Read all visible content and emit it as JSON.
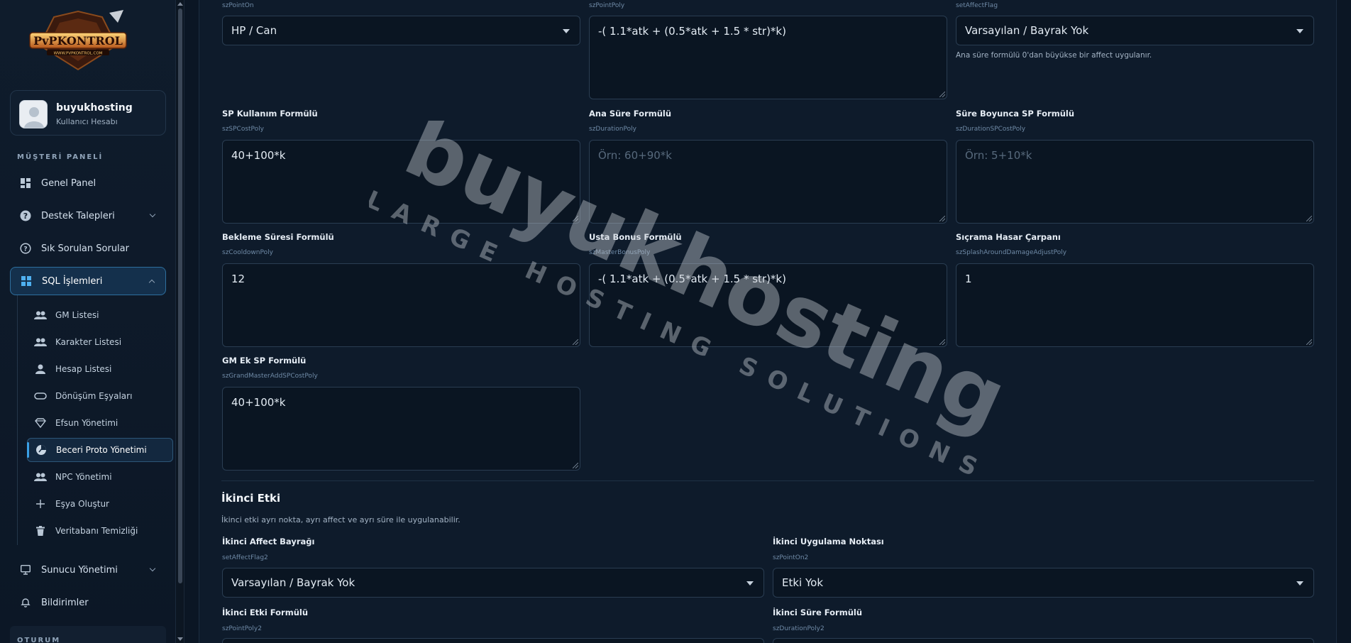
{
  "brand": {
    "logo_text": "PvPKONTROL",
    "logo_sub": "WWW.PVPKONTROL.COM"
  },
  "user": {
    "name": "buyukhosting",
    "role": "Kullanıcı Hesabı"
  },
  "sidebar": {
    "section_label": "MÜŞTERİ PANELİ",
    "items": [
      {
        "label": "Genel Panel",
        "icon": "dashboard-icon"
      },
      {
        "label": "Destek Talepleri",
        "icon": "question-icon"
      },
      {
        "label": "Sık Sorulan Sorular",
        "icon": "help-circle-icon"
      },
      {
        "label": "SQL İşlemleri",
        "icon": "grid-icon"
      }
    ],
    "subitems": [
      {
        "label": "GM Listesi",
        "icon": "users-icon"
      },
      {
        "label": "Karakter Listesi",
        "icon": "users-icon"
      },
      {
        "label": "Hesap Listesi",
        "icon": "user-icon"
      },
      {
        "label": "Dönüşüm Eşyaları",
        "icon": "ring-icon"
      },
      {
        "label": "Efsun Yönetimi",
        "icon": "diamond-icon"
      },
      {
        "label": "Beceri Proto Yönetimi",
        "icon": "pie-icon"
      },
      {
        "label": "NPC Yönetimi",
        "icon": "users-icon"
      },
      {
        "label": "Eşya Oluştur",
        "icon": "plus-icon"
      },
      {
        "label": "Veritabanı Temizliği",
        "icon": "trash-icon"
      }
    ],
    "bottom_items": [
      {
        "label": "Sunucu Yönetimi",
        "icon": "monitor-icon"
      },
      {
        "label": "Bildirimler",
        "icon": "bell-icon"
      }
    ],
    "session_label": "OTURUM"
  },
  "form": {
    "top": {
      "point_on": {
        "key": "szPointOn",
        "value": "HP / Can"
      },
      "point_poly": {
        "key": "szPointPoly",
        "value": "-( 1.1*atk + (0.5*atk +  1.5 * str)*k)"
      },
      "affect_flag": {
        "key": "setAffectFlag",
        "value": "Varsayılan / Bayrak Yok",
        "hint": "Ana süre formülü 0'dan büyükse bir affect uygulanır."
      }
    },
    "sp_cost": {
      "label": "SP Kullanım Formülü",
      "key": "szSPCostPoly",
      "value": "40+100*k"
    },
    "duration": {
      "label": "Ana Süre Formülü",
      "key": "szDurationPoly",
      "placeholder": "Örn: 60+90*k"
    },
    "duration_sp": {
      "label": "Süre Boyunca SP Formülü",
      "key": "szDurationSPCostPoly",
      "placeholder": "Örn: 5+10*k"
    },
    "cooldown": {
      "label": "Bekleme Süresi Formülü",
      "key": "szCooldownPoly",
      "value": "12"
    },
    "master_bonus": {
      "label": "Usta Bonus Formülü",
      "key": "szMasterBonusPoly",
      "value": "-( 1.1*atk + (0.5*atk +  1.5 * str)*k)"
    },
    "splash": {
      "label": "Sıçrama Hasar Çarpanı",
      "key": "szSplashAroundDamageAdjustPoly",
      "value": "1"
    },
    "gm_sp": {
      "label": "GM Ek SP Formülü",
      "key": "szGrandMasterAddSPCostPoly",
      "value": "40+100*k"
    },
    "second": {
      "title": "İkinci Etki",
      "desc": "İkinci etki ayrı nokta, ayrı affect ve ayrı süre ile uygulanabilir.",
      "affect_flag2": {
        "label": "İkinci Affect Bayrağı",
        "key": "setAffectFlag2",
        "value": "Varsayılan / Bayrak Yok"
      },
      "point_on2": {
        "label": "İkinci Uygulama Noktası",
        "key": "szPointOn2",
        "value": "Etki Yok"
      },
      "point_poly2": {
        "label": "İkinci Etki Formülü",
        "key": "szPointPoly2"
      },
      "duration_poly2": {
        "label": "İkinci Süre Formülü",
        "key": "szDurationPoly2"
      }
    }
  },
  "watermark": {
    "main": "buyukhosting",
    "sub": "LARGE HOSTING SOLUTIONS"
  }
}
